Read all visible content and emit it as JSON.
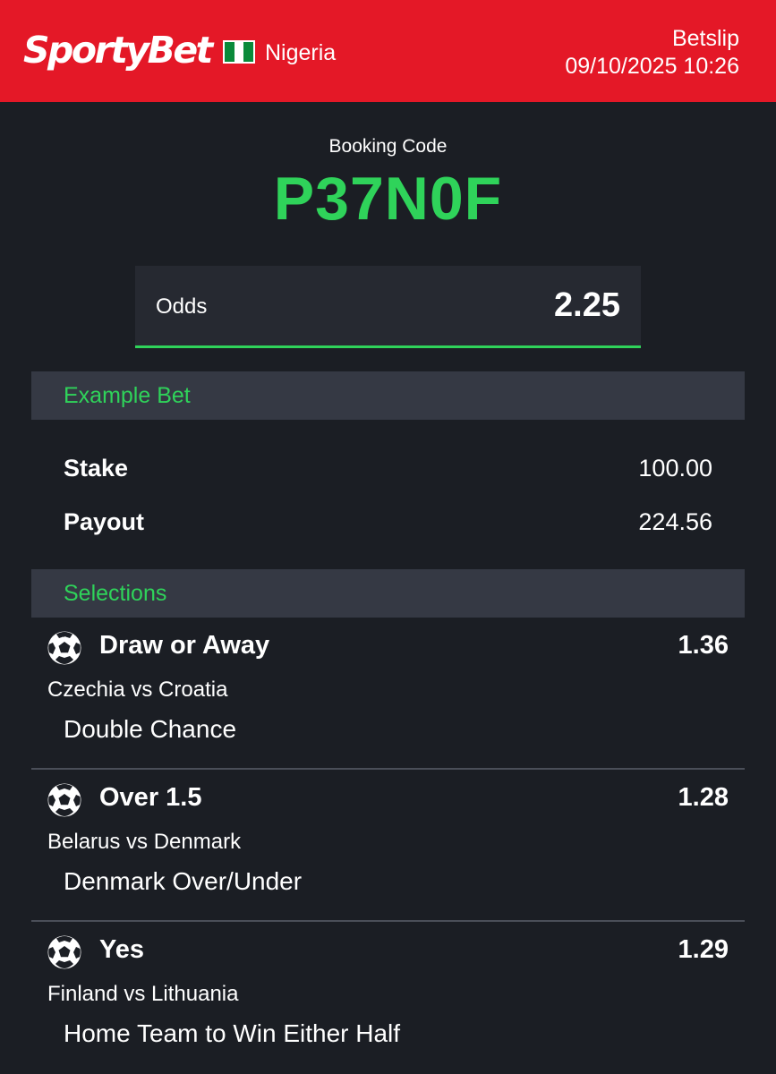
{
  "header": {
    "brand": "SportyBet",
    "country": "Nigeria",
    "title": "Betslip",
    "datetime": "09/10/2025 10:26",
    "bg_color": "#e41827"
  },
  "booking": {
    "label": "Booking Code",
    "code": "P37N0F",
    "code_color": "#2fd35a"
  },
  "odds": {
    "label": "Odds",
    "value": "2.25"
  },
  "example_bet": {
    "heading": "Example Bet",
    "stake_label": "Stake",
    "stake_value": "100.00",
    "payout_label": "Payout",
    "payout_value": "224.56"
  },
  "selections": {
    "heading": "Selections",
    "items": [
      {
        "icon": "soccer-ball-icon",
        "pick": "Draw or Away",
        "odds": "1.36",
        "match": "Czechia vs Croatia",
        "market": "Double Chance"
      },
      {
        "icon": "soccer-ball-icon",
        "pick": "Over 1.5",
        "odds": "1.28",
        "match": "Belarus vs Denmark",
        "market": "Denmark Over/Under"
      },
      {
        "icon": "soccer-ball-icon",
        "pick": "Yes",
        "odds": "1.29",
        "match": "Finland vs Lithuania",
        "market": "Home Team to Win Either Half"
      }
    ]
  }
}
